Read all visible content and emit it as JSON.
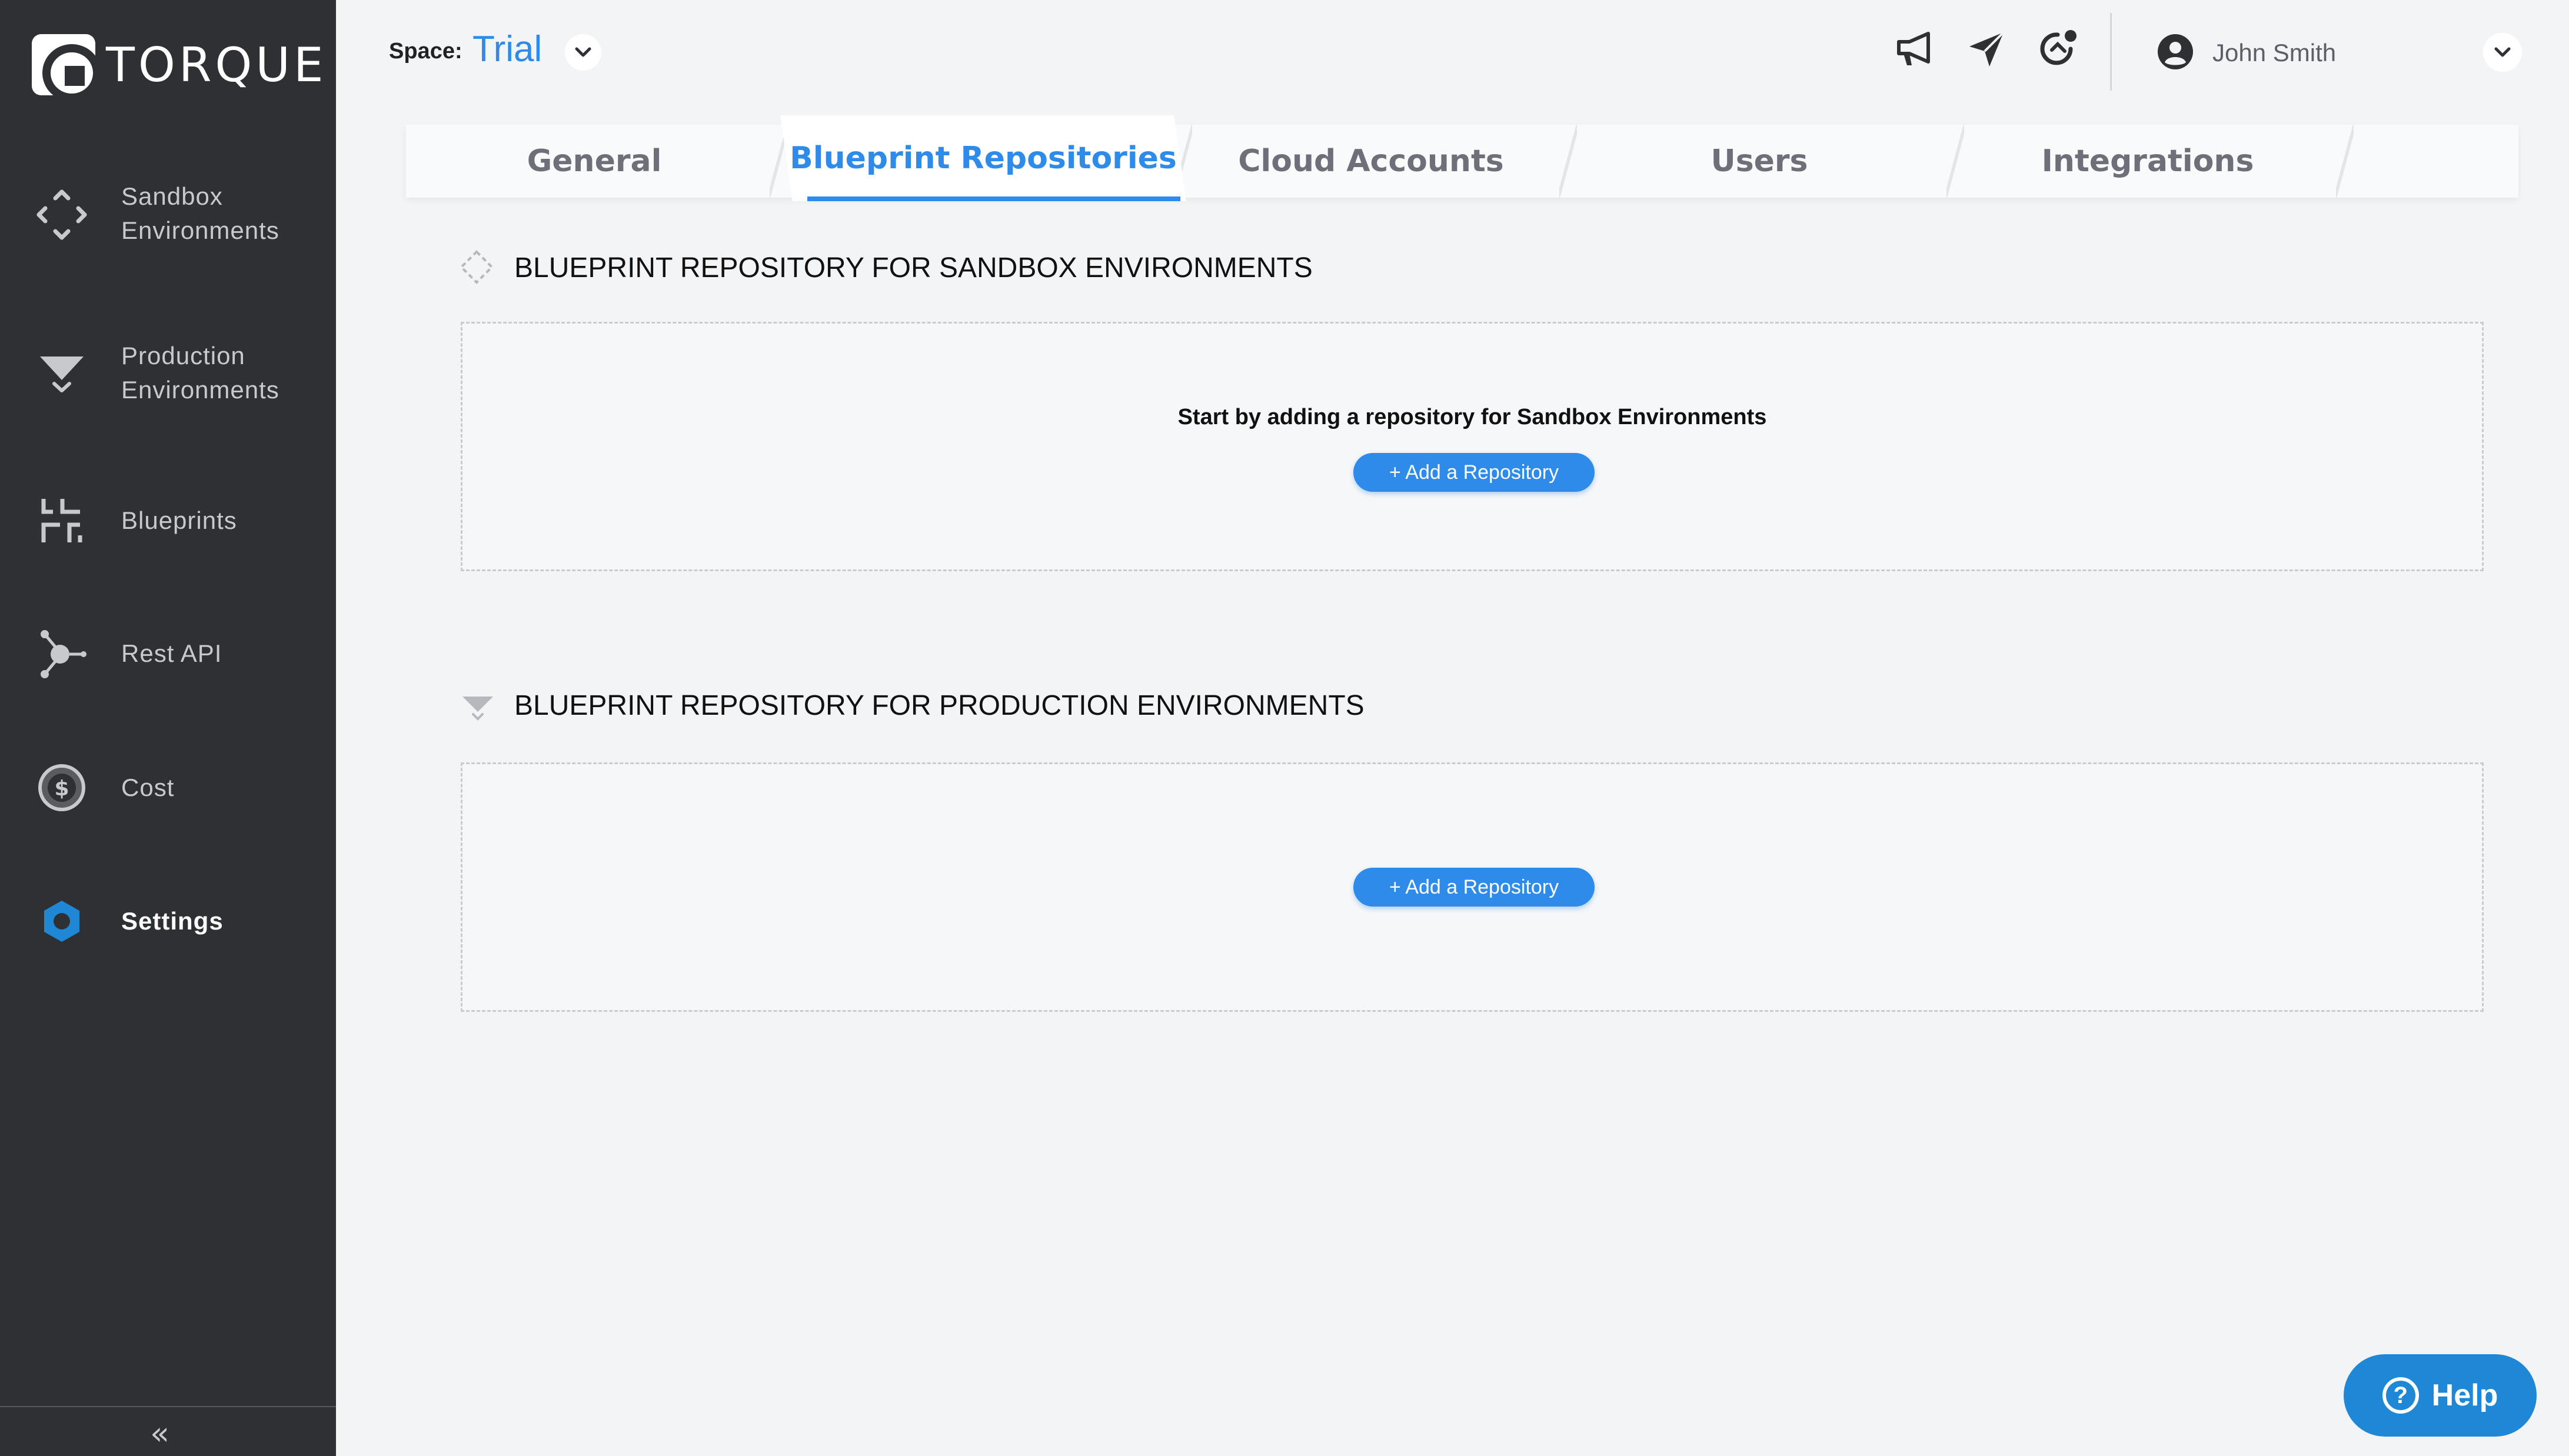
{
  "app": {
    "logo_text": "TORQUE"
  },
  "sidebar": {
    "items": [
      {
        "label_line1": "Sandbox",
        "label_line2": "Environments",
        "icon": "sandbox-diamond-icon"
      },
      {
        "label_line1": "Production",
        "label_line2": "Environments",
        "icon": "production-funnel-icon"
      },
      {
        "label": "Blueprints",
        "icon": "blueprints-icon"
      },
      {
        "label": "Rest API",
        "icon": "rest-api-icon"
      },
      {
        "label": "Cost",
        "icon": "cost-dollar-icon"
      },
      {
        "label": "Settings",
        "icon": "settings-hexagon-icon",
        "active": true
      }
    ],
    "collapse_glyph": "«"
  },
  "header": {
    "space_label": "Space:",
    "space_value": "Trial",
    "icons": [
      "megaphone-icon",
      "send-icon",
      "notifications-icon"
    ],
    "user_name": "John Smith"
  },
  "tabs": [
    {
      "label": "General",
      "active": false
    },
    {
      "label": "Blueprint Repositories",
      "active": true
    },
    {
      "label": "Cloud Accounts",
      "active": false
    },
    {
      "label": "Users",
      "active": false
    },
    {
      "label": "Integrations",
      "active": false
    }
  ],
  "sections": {
    "sandbox": {
      "title": "BLUEPRINT REPOSITORY FOR SANDBOX ENVIRONMENTS",
      "empty_message": "Start by adding a repository for Sandbox Environments",
      "button": "+ Add a Repository"
    },
    "production": {
      "title": "BLUEPRINT REPOSITORY FOR PRODUCTION ENVIRONMENTS",
      "button": "+ Add a Repository"
    }
  },
  "help": {
    "label": "Help",
    "glyph": "?"
  },
  "colors": {
    "accent": "#2e8bea",
    "sidebar_bg": "#2f3033",
    "help_bg": "#1e88d6"
  }
}
